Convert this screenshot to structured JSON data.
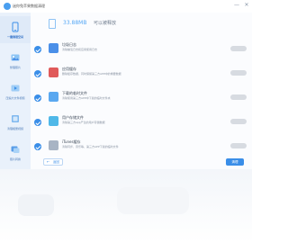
{
  "window": {
    "title": "迷你兔苹果数据清理",
    "minimize": "—",
    "close": "✕"
  },
  "sidebar": {
    "items": [
      {
        "label": "一键清理空间",
        "icon": "phone-clean-icon",
        "active": true
      },
      {
        "label": "整理照片",
        "icon": "photo-icon",
        "active": false
      },
      {
        "label": "压缩大文件视频",
        "icon": "video-compress-icon",
        "active": false
      },
      {
        "label": "清理相册视频",
        "icon": "photo-video-icon",
        "active": false
      },
      {
        "label": "照片转换",
        "icon": "photo-convert-icon",
        "active": false
      }
    ]
  },
  "summary": {
    "size": "33.88MB",
    "text": "可以被释放"
  },
  "rows": [
    {
      "title": "垃圾日志",
      "desc": "清除崩溃日志和应用使用日志",
      "button": "",
      "icon": "log-icon",
      "color": "#4a8fe8"
    },
    {
      "title": "应用缓存",
      "desc": "删除缓存数据，同时保留第三方APP中的重要数据",
      "button": "",
      "icon": "cache-icon",
      "color": "#e05a5a"
    },
    {
      "title": "下载的临时文件",
      "desc": "清除使用第三方APP中下载的临时文件夹",
      "button": "",
      "icon": "download-icon",
      "color": "#5aa8f0"
    },
    {
      "title": "用户存储文件",
      "desc": "清除第三方app产生的用户存储数据",
      "button": "",
      "icon": "storage-icon",
      "color": "#4fb8e8"
    },
    {
      "title": "iTunes缓存",
      "desc": "清除同步、音乐等，第三方APP下载的临时文件",
      "button": "",
      "icon": "itunes-icon",
      "color": "#a8b4c4"
    }
  ],
  "bottom": {
    "back": "返回",
    "clean": "清理"
  },
  "colors": {
    "accent": "#3a8ee8",
    "sidebar_bg": "#e9f1fb",
    "summary_size": "#56a8f5"
  }
}
